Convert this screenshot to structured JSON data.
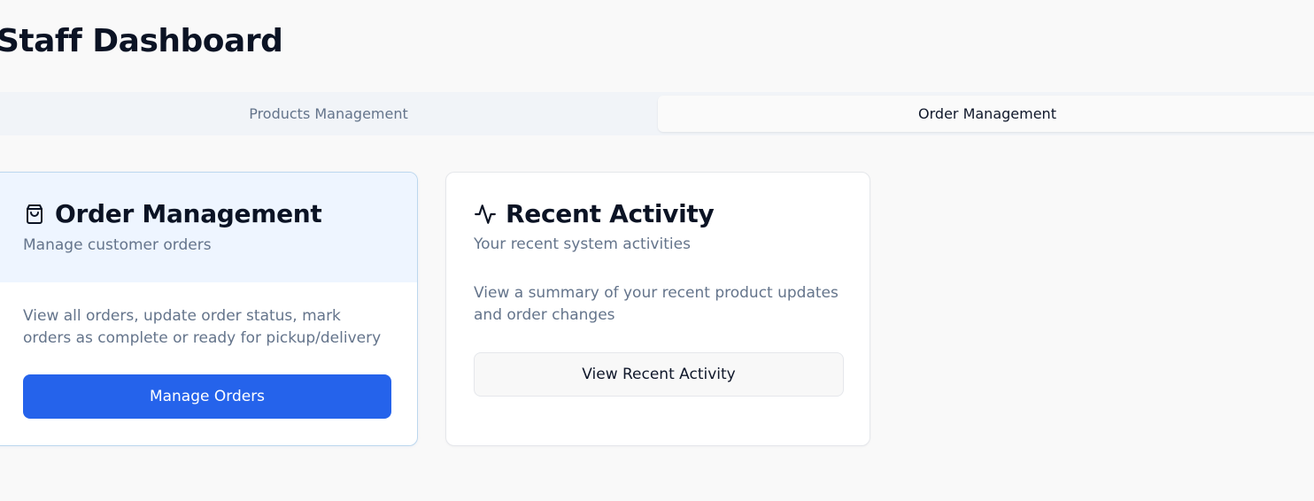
{
  "page": {
    "title": "Staff Dashboard"
  },
  "tabs": [
    {
      "label": "Products Management",
      "active": false
    },
    {
      "label": "Order Management",
      "active": true
    }
  ],
  "cards": {
    "order_management": {
      "icon": "shopping-bag-icon",
      "title": "Order Management",
      "subtitle": "Manage customer orders",
      "description": "View all orders, update order status, mark orders as complete or ready for pickup/delivery",
      "button_label": "Manage Orders"
    },
    "recent_activity": {
      "icon": "activity-pulse-icon",
      "title": "Recent Activity",
      "subtitle": "Your recent system activities",
      "description": "View a summary of your recent product updates and order changes",
      "button_label": "View Recent Activity"
    }
  },
  "colors": {
    "primary": "#2563eb",
    "highlight_header": "#eef5ff",
    "highlight_border": "#bcd7ee",
    "muted_text": "#64748b",
    "heading_text": "#0b1324"
  }
}
